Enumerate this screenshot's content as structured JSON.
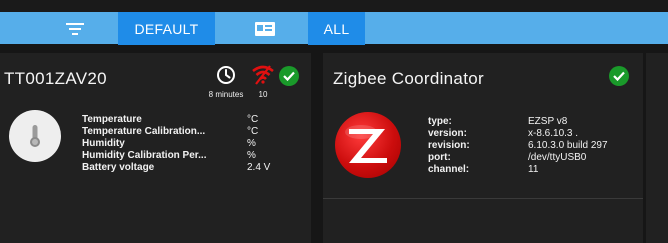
{
  "toolbar": {
    "filter_icon": "filter-icon",
    "default_label": "DEFAULT",
    "view_icon": "card-view-icon",
    "all_label": "ALL"
  },
  "devices": [
    {
      "title": "TT001ZAV20",
      "last_seen_icon": "clock-icon",
      "last_seen": "8 minutes",
      "link_icon": "wifi-signal-icon",
      "link_quality": "10",
      "status_icon": "check-circle-icon",
      "image": "thermometer-sensor",
      "properties": [
        {
          "name": "Temperature",
          "value": "°C"
        },
        {
          "name": "Temperature Calibration...",
          "value": "°C"
        },
        {
          "name": "Humidity",
          "value": "%"
        },
        {
          "name": "Humidity Calibration Per...",
          "value": "%"
        },
        {
          "name": "Battery voltage",
          "value": "2.4 V"
        }
      ]
    },
    {
      "title": "Zigbee Coordinator",
      "status_icon": "check-circle-icon",
      "image": "zigbee-logo",
      "properties": [
        {
          "name": "type:",
          "value": "EZSP v8"
        },
        {
          "name": "version:",
          "value": "x-8.6.10.3 ."
        },
        {
          "name": "revision:",
          "value": "6.10.3.0 build 297"
        },
        {
          "name": "port:",
          "value": "/dev/ttyUSB0"
        },
        {
          "name": "channel:",
          "value": "11"
        }
      ]
    }
  ],
  "colors": {
    "toolbar": "#56aeea",
    "button": "#1f8ce8",
    "card": "#212121",
    "status_ok": "#1a9a2a",
    "link_warn": "#e01010",
    "zigbee_red": "#cc0d0d"
  }
}
